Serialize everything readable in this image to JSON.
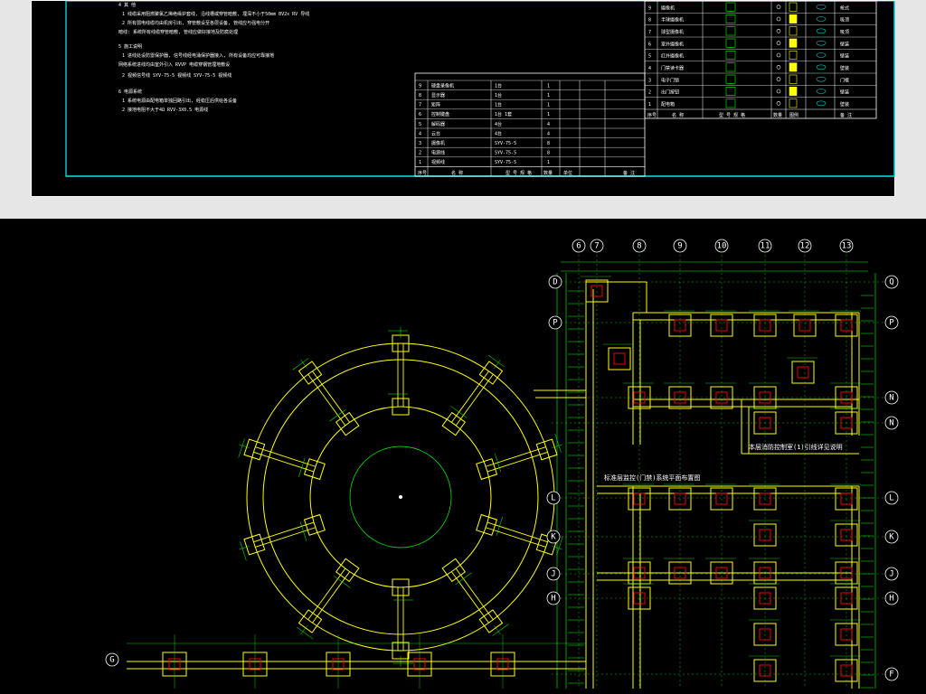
{
  "notes": {
    "lines": [
      "4  其 他",
      "1  线缆采用阻燃聚氯乙烯绝缘护套线, 沿线槽或穿管暗敷, 埋深不小于50mm      BV2x  RV 导线",
      "2  所有弱电线缆均由机房引出, 穿管敷设至各层设备, 管线应与强电分开",
      "   暗线:  系统所有线缆穿管暗敷, 管线应做好接地及防腐处理",
      "5  施工说明",
      "1  进线处设防雷保护器, 信号线经电涌保护器接入, 所有设备均应可靠接地",
      "   网络系统进线均由室外引入    RVVP    电缆穿钢管埋地敷设",
      "2  视频信号线                  SYV-75-5        视频线    SYV-75-5        视频线",
      "6  电源系统",
      "1  系统电源由配电箱单独回路引出, 经稳压后供给各设备",
      "2  接地电阻不大于4Ω      RVV-3X0.5      电源线"
    ]
  },
  "table_left": {
    "rows": [
      [
        "9",
        "硬盘录像机",
        "1台",
        "1"
      ],
      [
        "8",
        "显示器",
        "1台",
        "1"
      ],
      [
        "7",
        "矩阵",
        "1台",
        "1"
      ],
      [
        "6",
        "控制键盘",
        "1台  1套",
        "1"
      ],
      [
        "5",
        "解码器",
        "4台",
        "4"
      ],
      [
        "4",
        "云台",
        "4台",
        "4"
      ],
      [
        "3",
        "摄像机",
        "SYV-75-5",
        "8"
      ],
      [
        "2",
        "电源线",
        "SYV-75-5",
        "8"
      ],
      [
        "1",
        "视频线",
        "SYV-75-5",
        "1"
      ]
    ],
    "header": [
      "序号",
      "名 称",
      "型 号 规 格",
      "数量",
      "单位",
      "备 注"
    ]
  },
  "table_right": {
    "rows": [
      [
        "9",
        "摄像机",
        "枪式"
      ],
      [
        "8",
        "半球摄像机",
        "吸顶"
      ],
      [
        "7",
        "球型摄像机",
        "吸顶"
      ],
      [
        "6",
        "室外摄像机",
        "壁装"
      ],
      [
        "5",
        "红外摄像机",
        "壁装"
      ],
      [
        "4",
        "门禁读卡器",
        "壁装"
      ],
      [
        "3",
        "电子门锁",
        "门框"
      ],
      [
        "2",
        "出门按钮",
        "壁装"
      ],
      [
        "1",
        "配电箱",
        "壁装"
      ]
    ],
    "header": [
      "序号",
      "名 称",
      "型 号 规 格",
      "数量",
      "图例",
      "备 注"
    ]
  },
  "plan": {
    "top_axes": [
      "6",
      "7",
      "8",
      "9",
      "10",
      "11",
      "12",
      "13"
    ],
    "right_axes": [
      "Q",
      "P",
      "N",
      "N",
      "L",
      "K",
      "J",
      "H",
      "F"
    ],
    "left_axes": [
      "D",
      "P",
      "L",
      "K",
      "J",
      "H",
      "G"
    ],
    "annotations": [
      "本层消防控制室(1)引线详见说明",
      "标准层监控(门禁)系统平面布置图"
    ]
  },
  "colors": {
    "background": "#000000",
    "frame": "#00c8c8",
    "structure": "#ffff00",
    "dimension": "#00ff00",
    "marker": "#ff0000",
    "text": "#ffffff",
    "page": "#e6e6e6"
  }
}
